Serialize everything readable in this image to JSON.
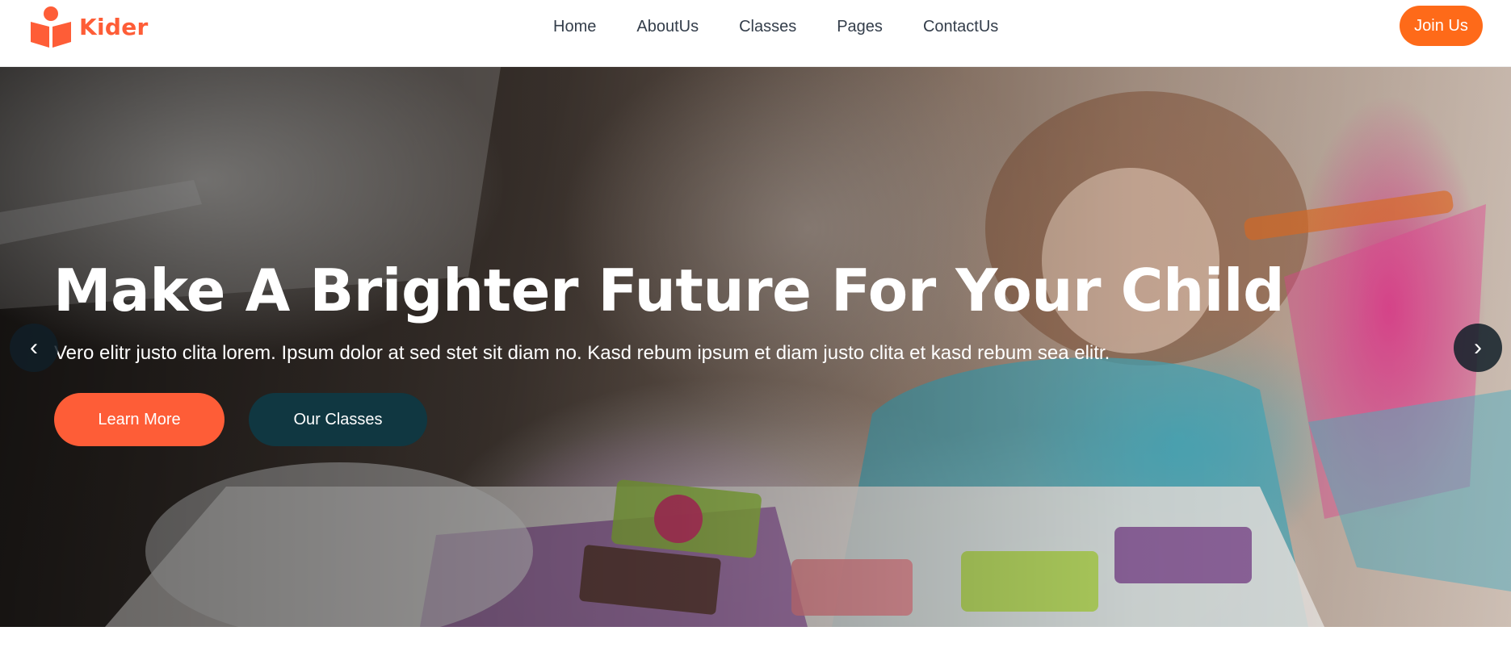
{
  "brand": {
    "name": "Kider",
    "icon": "book-reader-icon",
    "color": "#fe5d37"
  },
  "nav": {
    "items": [
      {
        "label": "Home"
      },
      {
        "label": "AboutUs"
      },
      {
        "label": "Classes"
      },
      {
        "label": "Pages"
      },
      {
        "label": "ContactUs"
      }
    ],
    "join_label": "Join Us",
    "join_color": "#fe6a19"
  },
  "hero": {
    "title": "Make A Brighter Future For Your Child",
    "subtitle": "Vero elitr justo clita lorem. Ipsum dolor at sed stet sit diam no. Kasd rebum ipsum et diam justo clita et kasd rebum sea elitr.",
    "primary_button": "Learn More",
    "secondary_button": "Our Classes",
    "primary_color": "#fe5d37",
    "secondary_color": "#103741",
    "prev_icon": "‹",
    "next_icon": "›"
  }
}
